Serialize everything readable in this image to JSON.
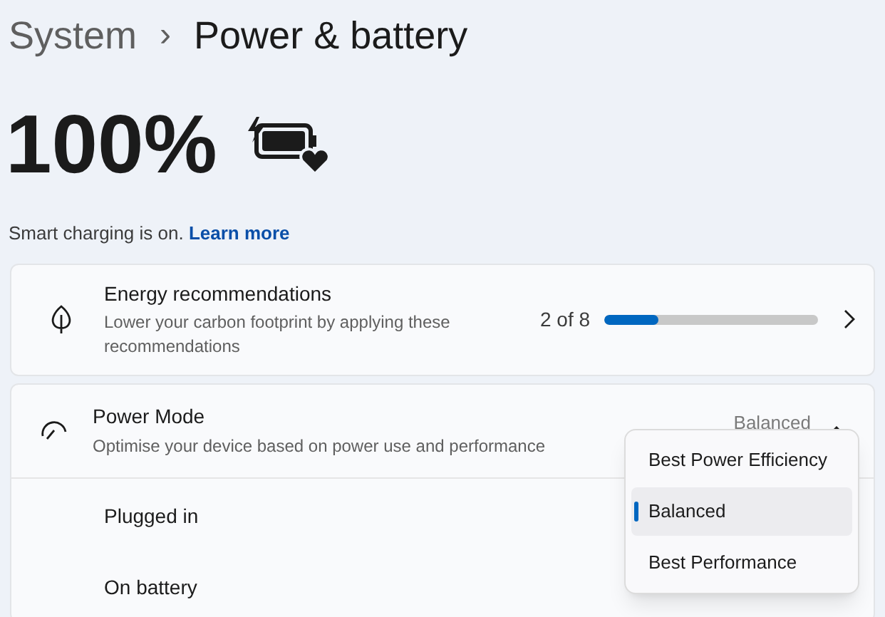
{
  "breadcrumb": {
    "parent": "System",
    "separator": "›",
    "current": "Power & battery"
  },
  "battery": {
    "percent": "100%"
  },
  "smart_charging": {
    "text": "Smart charging is on.",
    "link": "Learn more"
  },
  "energy_recommendations": {
    "title": "Energy recommendations",
    "description": "Lower your carbon footprint by applying these recommendations",
    "count": "2 of 8",
    "level": 0.25
  },
  "power_mode": {
    "title": "Power Mode",
    "description": "Optimise your device based on power use and performance",
    "value": "Balanced",
    "expanded": true,
    "rows": [
      {
        "label": "Plugged in"
      },
      {
        "label": "On battery"
      }
    ],
    "menu": [
      {
        "label": "Best Power Efficiency",
        "selected": false
      },
      {
        "label": "Balanced",
        "selected": true
      },
      {
        "label": "Best Performance",
        "selected": false
      }
    ]
  }
}
